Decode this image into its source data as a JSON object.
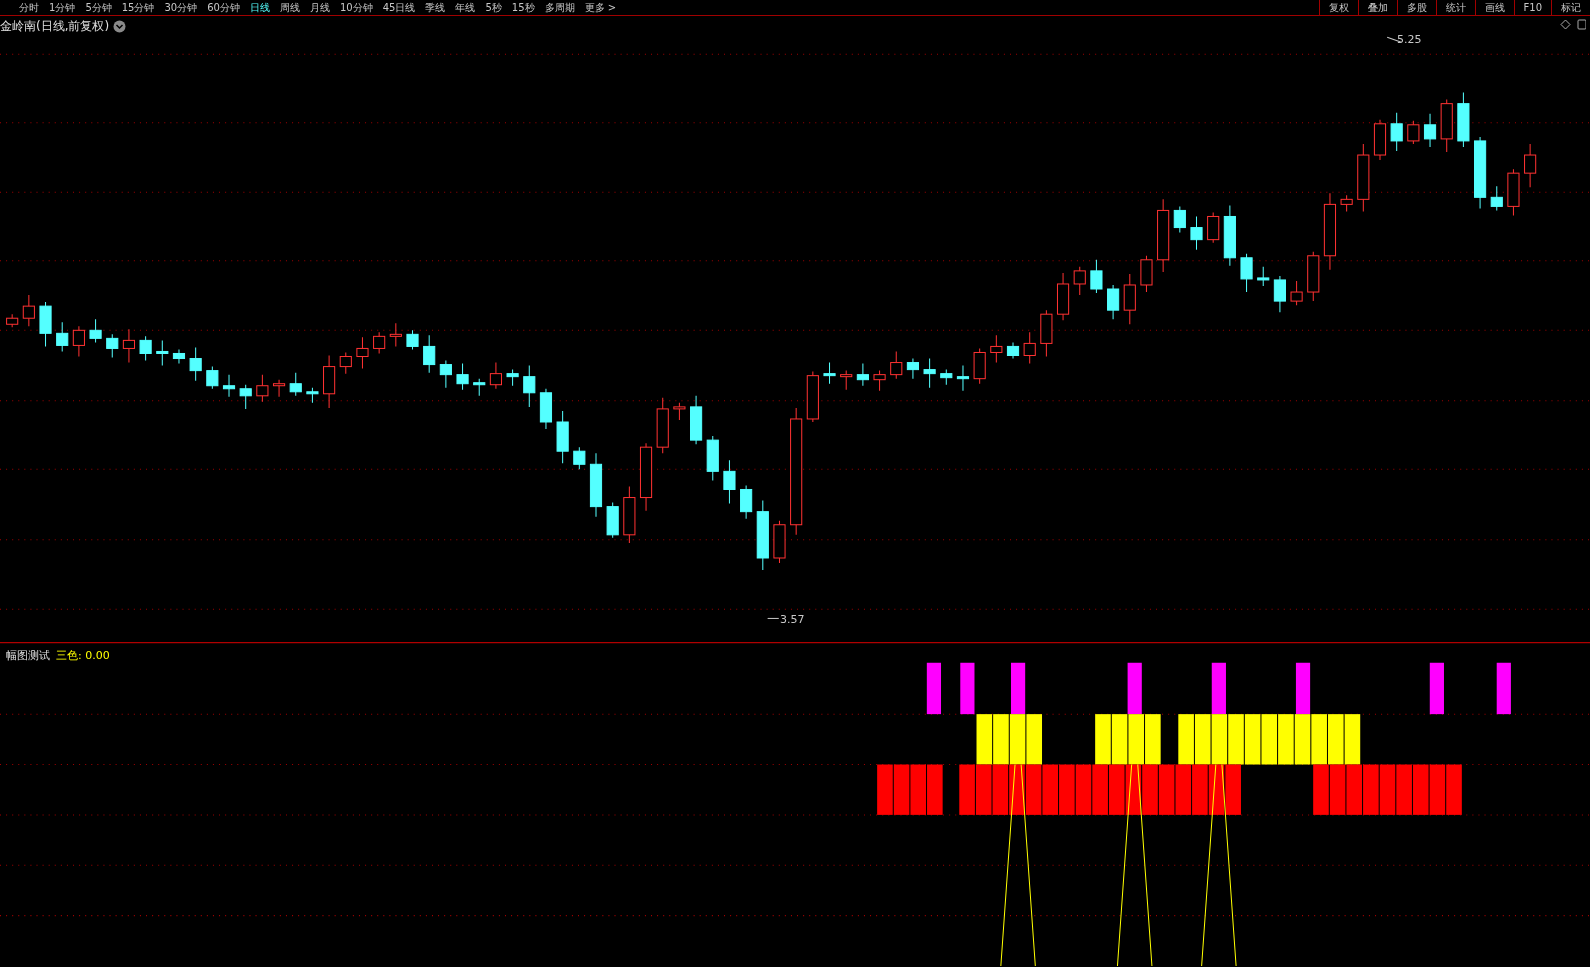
{
  "period_tabs": [
    {
      "label": "分时",
      "selected": false
    },
    {
      "label": "1分钟",
      "selected": false
    },
    {
      "label": "5分钟",
      "selected": false
    },
    {
      "label": "15分钟",
      "selected": false
    },
    {
      "label": "30分钟",
      "selected": false
    },
    {
      "label": "60分钟",
      "selected": false
    },
    {
      "label": "日线",
      "selected": true
    },
    {
      "label": "周线",
      "selected": false
    },
    {
      "label": "月线",
      "selected": false
    },
    {
      "label": "10分钟",
      "selected": false
    },
    {
      "label": "45日线",
      "selected": false
    },
    {
      "label": "季线",
      "selected": false
    },
    {
      "label": "年线",
      "selected": false
    },
    {
      "label": "5秒",
      "selected": false
    },
    {
      "label": "15秒",
      "selected": false
    },
    {
      "label": "多周期",
      "selected": false
    },
    {
      "label": "更多 >",
      "selected": false
    }
  ],
  "tool_buttons": [
    "复权",
    "叠加",
    "多股",
    "统计",
    "画线",
    "F10",
    "标记"
  ],
  "chart_title": "金岭南(日线,前复权)",
  "price_high_label": "5.25",
  "price_low_label": "3.57",
  "indicator": {
    "name": "幅图测试",
    "value_label": "三色: 0.00"
  }
}
